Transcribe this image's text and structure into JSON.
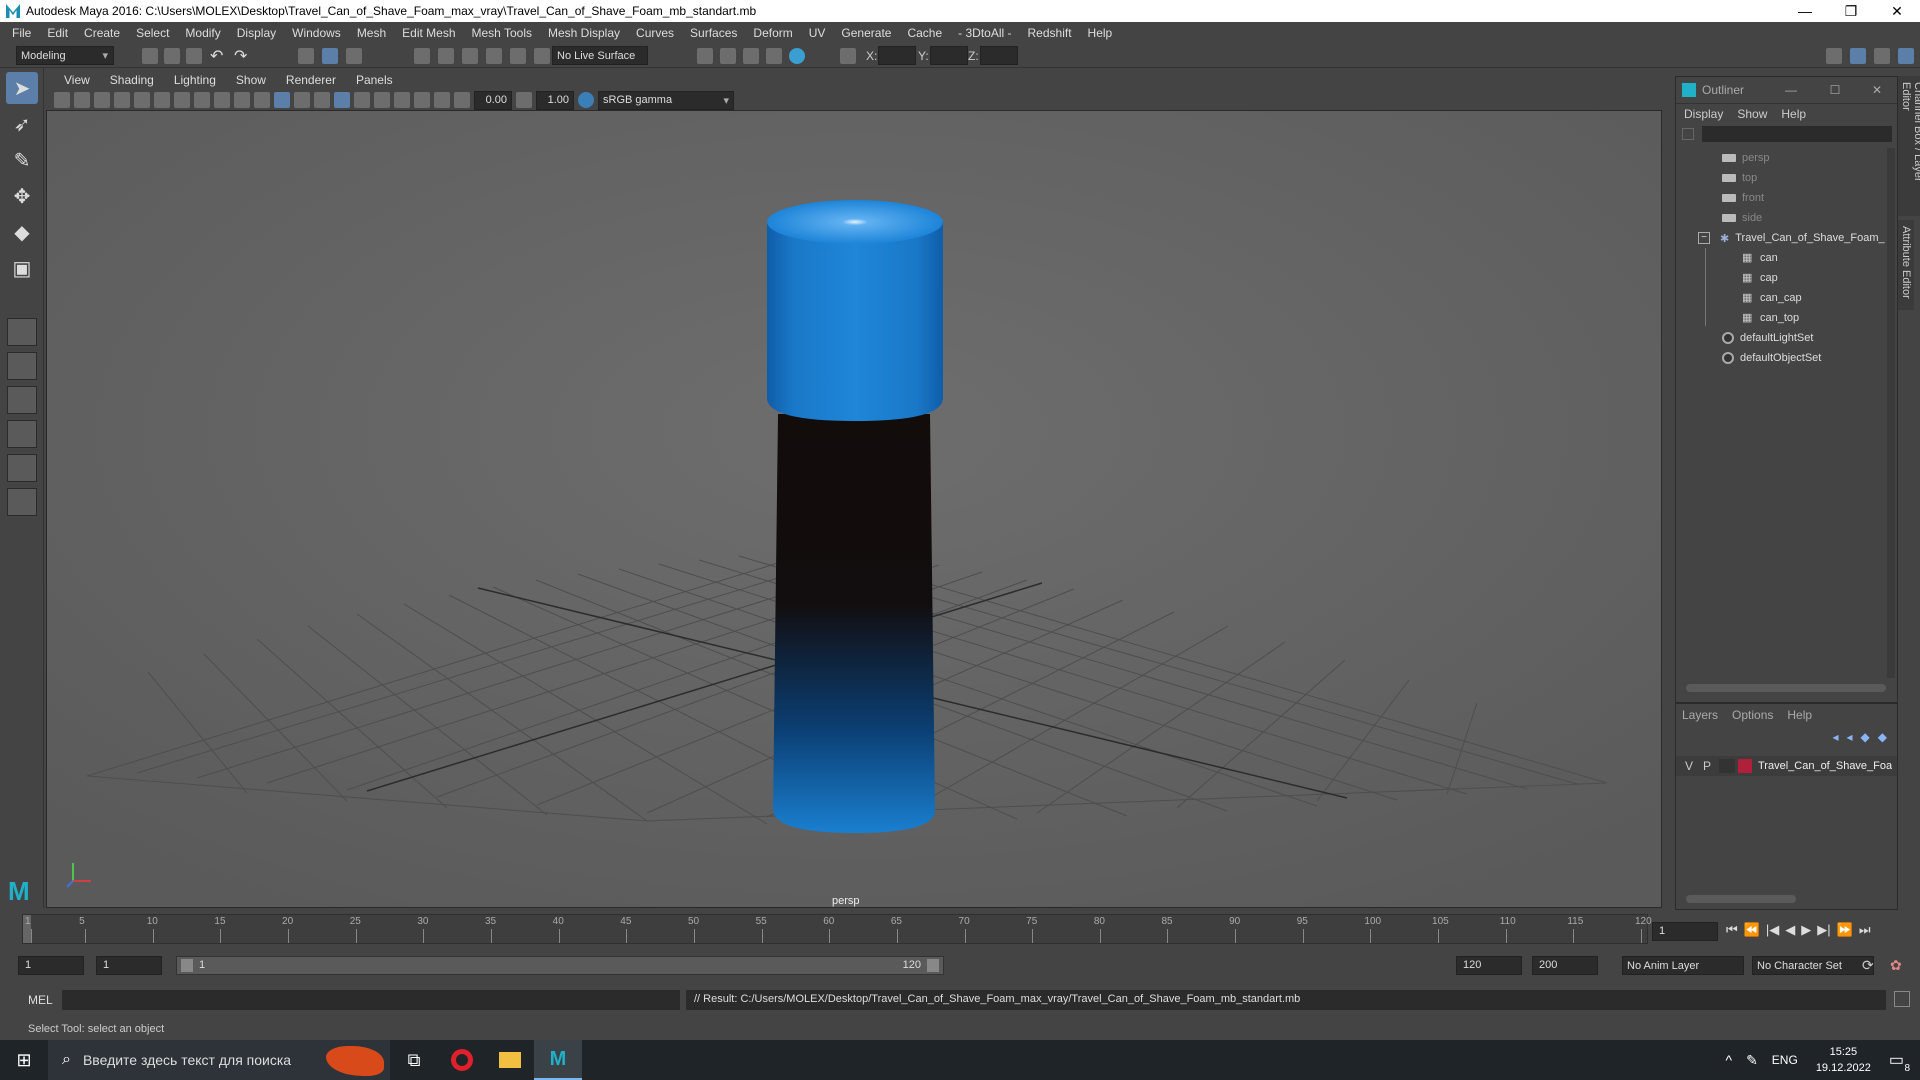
{
  "window": {
    "title": "Autodesk Maya 2016: C:\\Users\\MOLEX\\Desktop\\Travel_Can_of_Shave_Foam_max_vray\\Travel_Can_of_Shave_Foam_mb_standart.mb",
    "minimize": "—",
    "maximize": "❐",
    "close": "✕"
  },
  "menubar": [
    "File",
    "Edit",
    "Create",
    "Select",
    "Modify",
    "Display",
    "Windows",
    "Mesh",
    "Edit Mesh",
    "Mesh Tools",
    "Mesh Display",
    "Curves",
    "Surfaces",
    "Deform",
    "UV",
    "Generate",
    "Cache",
    "- 3DtoAll -",
    "Redshift",
    "Help"
  ],
  "toolbar": {
    "mode": "Modeling",
    "live_surface": "No Live Surface",
    "x_label": "X:",
    "y_label": "Y:",
    "z_label": "Z:"
  },
  "viewport": {
    "menus": [
      "View",
      "Shading",
      "Lighting",
      "Show",
      "Renderer",
      "Panels"
    ],
    "exposure": "0.00",
    "gamma": "1.00",
    "colorspace": "sRGB gamma",
    "camera_label": "persp"
  },
  "outliner": {
    "title": "Outliner",
    "menus": [
      "Display",
      "Show",
      "Help"
    ],
    "cameras": [
      "persp",
      "top",
      "front",
      "side"
    ],
    "group": "Travel_Can_of_Shave_Foam_",
    "children": [
      "can",
      "cap",
      "can_cap",
      "can_top"
    ],
    "sets": [
      "defaultLightSet",
      "defaultObjectSet"
    ]
  },
  "layers": {
    "menus": [
      "Layers",
      "Options",
      "Help"
    ],
    "row": {
      "v": "V",
      "p": "P",
      "name": "Travel_Can_of_Shave_Foa",
      "color": "#b0203a"
    }
  },
  "side_tabs": [
    "Channel Box / Layer Editor",
    "Attribute Editor"
  ],
  "timeline": {
    "ticks": [
      "1",
      "5",
      "10",
      "15",
      "20",
      "25",
      "30",
      "35",
      "40",
      "45",
      "50",
      "55",
      "60",
      "65",
      "70",
      "75",
      "80",
      "85",
      "90",
      "95",
      "100",
      "105",
      "110",
      "115",
      "120"
    ],
    "current_frame": "1",
    "playback_buttons": [
      "⏮",
      "⏪",
      "|◀",
      "◀",
      "▶",
      "▶|",
      "⏩",
      "⏭"
    ]
  },
  "range": {
    "start": "1",
    "start2": "1",
    "slider_start": "1",
    "slider_end": "120",
    "end": "120",
    "end2": "200",
    "anim_layer": "No Anim Layer",
    "char_set": "No Character Set"
  },
  "cmdline": {
    "lang": "MEL",
    "result": "// Result: C:/Users/MOLEX/Desktop/Travel_Can_of_Shave_Foam_max_vray/Travel_Can_of_Shave_Foam_mb_standart.mb"
  },
  "helpline": "Select Tool: select an object",
  "taskbar": {
    "search_placeholder": "Введите здесь текст для поиска",
    "lang": "ENG",
    "time": "15:25",
    "date": "19.12.2022",
    "notif_count": "8"
  },
  "colors": {
    "cap": "#1e7fd0",
    "can_dark": "#141010",
    "accent": "#5b7fa8"
  }
}
